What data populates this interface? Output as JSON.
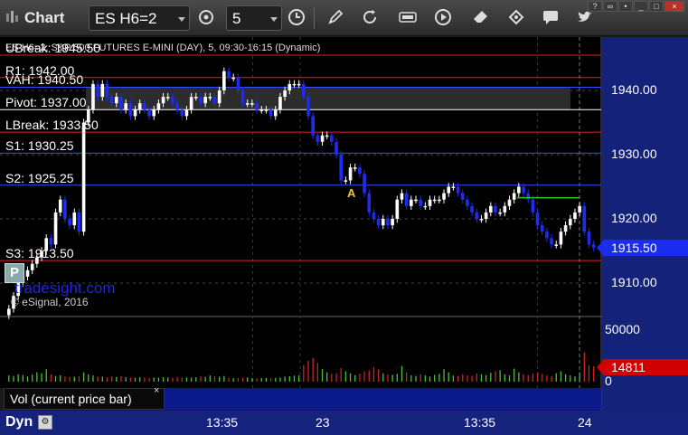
{
  "toolbar": {
    "app_title": "Chart",
    "symbol": "ES H6=2",
    "interval": "5",
    "icons": [
      "crosshair-gear-icon",
      "clock-icon",
      "pencil-icon",
      "refresh-icon",
      "get-icon",
      "play-icon",
      "tag-icon",
      "chat-icon",
      "twitter-icon"
    ]
  },
  "chart_header": {
    "info_text": "ES H6=2, S&P 500 FUTURES E-MINI (DAY), 5, 09:30-16:15 (Dynamic)"
  },
  "levels": [
    {
      "label": "UBreak: 1945.50",
      "value": 1945.5,
      "color": "#e02020"
    },
    {
      "label": "R1: 1942.00",
      "value": 1942.0,
      "color": "#e02020"
    },
    {
      "label": "VAH: 1940.50",
      "value": 1940.5,
      "color": "#3050ff"
    },
    {
      "label": "Pivot: 1937.00",
      "value": 1937.0,
      "color": "#ffffff"
    },
    {
      "label": "LBreak: 1933.50",
      "value": 1933.5,
      "color": "#e02020"
    },
    {
      "label": "S1: 1930.25",
      "value": 1930.25,
      "color": "#3050ff"
    },
    {
      "label": "S2: 1925.25",
      "value": 1925.25,
      "color": "#3050ff"
    },
    {
      "label": "S3: 1913.50",
      "value": 1913.5,
      "color": "#e02020"
    }
  ],
  "price_axis": {
    "ticks": [
      "1940.00",
      "1930.00",
      "1920.00",
      "1910.00"
    ],
    "tick_values": [
      1940,
      1930,
      1920,
      1910
    ]
  },
  "volume_axis": {
    "ticks": [
      "50000",
      "0"
    ],
    "tick_values": [
      50000,
      0
    ]
  },
  "time_axis": {
    "labels": [
      "13:35",
      "23",
      "13:35",
      "24"
    ]
  },
  "current_price": "1915.50",
  "current_volume": "14811",
  "volume_legend": "Vol (current price bar)",
  "volume_legend_close": "×",
  "watermark": "tradesight.com",
  "copyright": "© eSignal, 2016",
  "marker_label": "A",
  "p_tag": "P",
  "bottom_label": "Dyn",
  "colors": {
    "up_bar": "#ffffff",
    "down_bar": "#1f2cf0",
    "volume_up": "#4fbf3a",
    "volume_down": "#cc2222",
    "axis_bg": "#14227a"
  },
  "chart_data": {
    "type": "candlestick",
    "price_range": [
      1905,
      1950
    ],
    "closes": [
      1906,
      1908,
      1910,
      1911,
      1912,
      1913,
      1914,
      1915,
      1917,
      1916,
      1921,
      1923,
      1920,
      1919,
      1921,
      1918,
      1935,
      1937,
      1941,
      1939,
      1941,
      1939,
      1938,
      1939,
      1937,
      1938,
      1936,
      1937,
      1938,
      1937,
      1936,
      1937,
      1938,
      1939,
      1939,
      1938,
      1937,
      1936,
      1937,
      1939,
      1939,
      1938,
      1939,
      1939,
      1938,
      1940,
      1943,
      1942,
      1942,
      1940,
      1938,
      1938,
      1938,
      1937,
      1937,
      1937,
      1936,
      1937,
      1939,
      1940,
      1941,
      1941,
      1941,
      1939,
      1936,
      1933,
      1932,
      1933,
      1933,
      1932,
      1930,
      1926,
      1926,
      1928,
      1928,
      1927,
      1924,
      1921,
      1920,
      1919,
      1920,
      1919,
      1920,
      1923,
      1924,
      1922,
      1923,
      1923,
      1922,
      1922,
      1923,
      1923,
      1923,
      1924,
      1925,
      1925,
      1924,
      1923,
      1922,
      1921,
      1920,
      1920,
      1921,
      1922,
      1921,
      1921,
      1922,
      1923,
      1924,
      1925,
      1924,
      1923,
      1921,
      1919,
      1918,
      1917,
      1916,
      1916,
      1918,
      1919,
      1920,
      1921,
      1922,
      1918,
      1916,
      1915.5
    ],
    "volume": [
      6000,
      5500,
      7000,
      6200,
      5000,
      6800,
      9000,
      8000,
      12000,
      7000,
      5500,
      6000,
      5000,
      4500,
      4800,
      5200,
      9000,
      7000,
      6000,
      5000,
      4800,
      4200,
      5000,
      4600,
      5200,
      4400,
      4000,
      3800,
      4200,
      4000,
      3600,
      4100,
      3900,
      4300,
      4000,
      3800,
      4500,
      3700,
      4100,
      4000,
      4200,
      5000,
      4700,
      6000,
      5200,
      4800,
      5500,
      3800,
      3200,
      3600,
      3900,
      4100,
      3400,
      3000,
      3500,
      3700,
      3300,
      3600,
      4000,
      4800,
      5200,
      5800,
      6000,
      16000,
      20000,
      23000,
      18000,
      12000,
      9000,
      7500,
      8000,
      13000,
      10000,
      8000,
      6200,
      7600,
      9800,
      11000,
      14000,
      12000,
      8000,
      7000,
      6500,
      7600,
      15000,
      9000,
      6000,
      5500,
      7000,
      6000,
      5000,
      6500,
      7500,
      12000,
      9000,
      6000,
      5500,
      7000,
      6200,
      5800,
      8000,
      7000,
      6200,
      8500,
      10000,
      11000,
      7000,
      6000,
      12500,
      9000,
      7000,
      6500,
      8000,
      9000,
      7500,
      6000,
      5500,
      8000,
      10000,
      7000,
      6000,
      5000,
      9000,
      28000,
      16000,
      14811
    ],
    "volume_range": [
      0,
      60000
    ],
    "x_labels": [
      "13:35",
      "23",
      "13:35",
      "24"
    ]
  }
}
